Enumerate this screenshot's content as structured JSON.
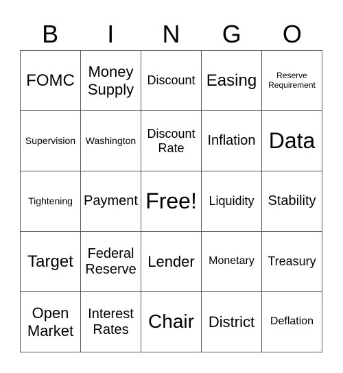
{
  "header": [
    "B",
    "I",
    "N",
    "G",
    "O"
  ],
  "cells": [
    [
      "FOMC",
      "Money Supply",
      "Discount",
      "Easing",
      "Reserve Requirement"
    ],
    [
      "Supervision",
      "Washington",
      "Discount Rate",
      "Inflation",
      "Data"
    ],
    [
      "Tightening",
      "Payment",
      "Free!",
      "Liquidity",
      "Stability"
    ],
    [
      "Target",
      "Federal Reserve",
      "Lender",
      "Monetary",
      "Treasury"
    ],
    [
      "Open Market",
      "Interest Rates",
      "Chair",
      "District",
      "Deflation"
    ]
  ]
}
